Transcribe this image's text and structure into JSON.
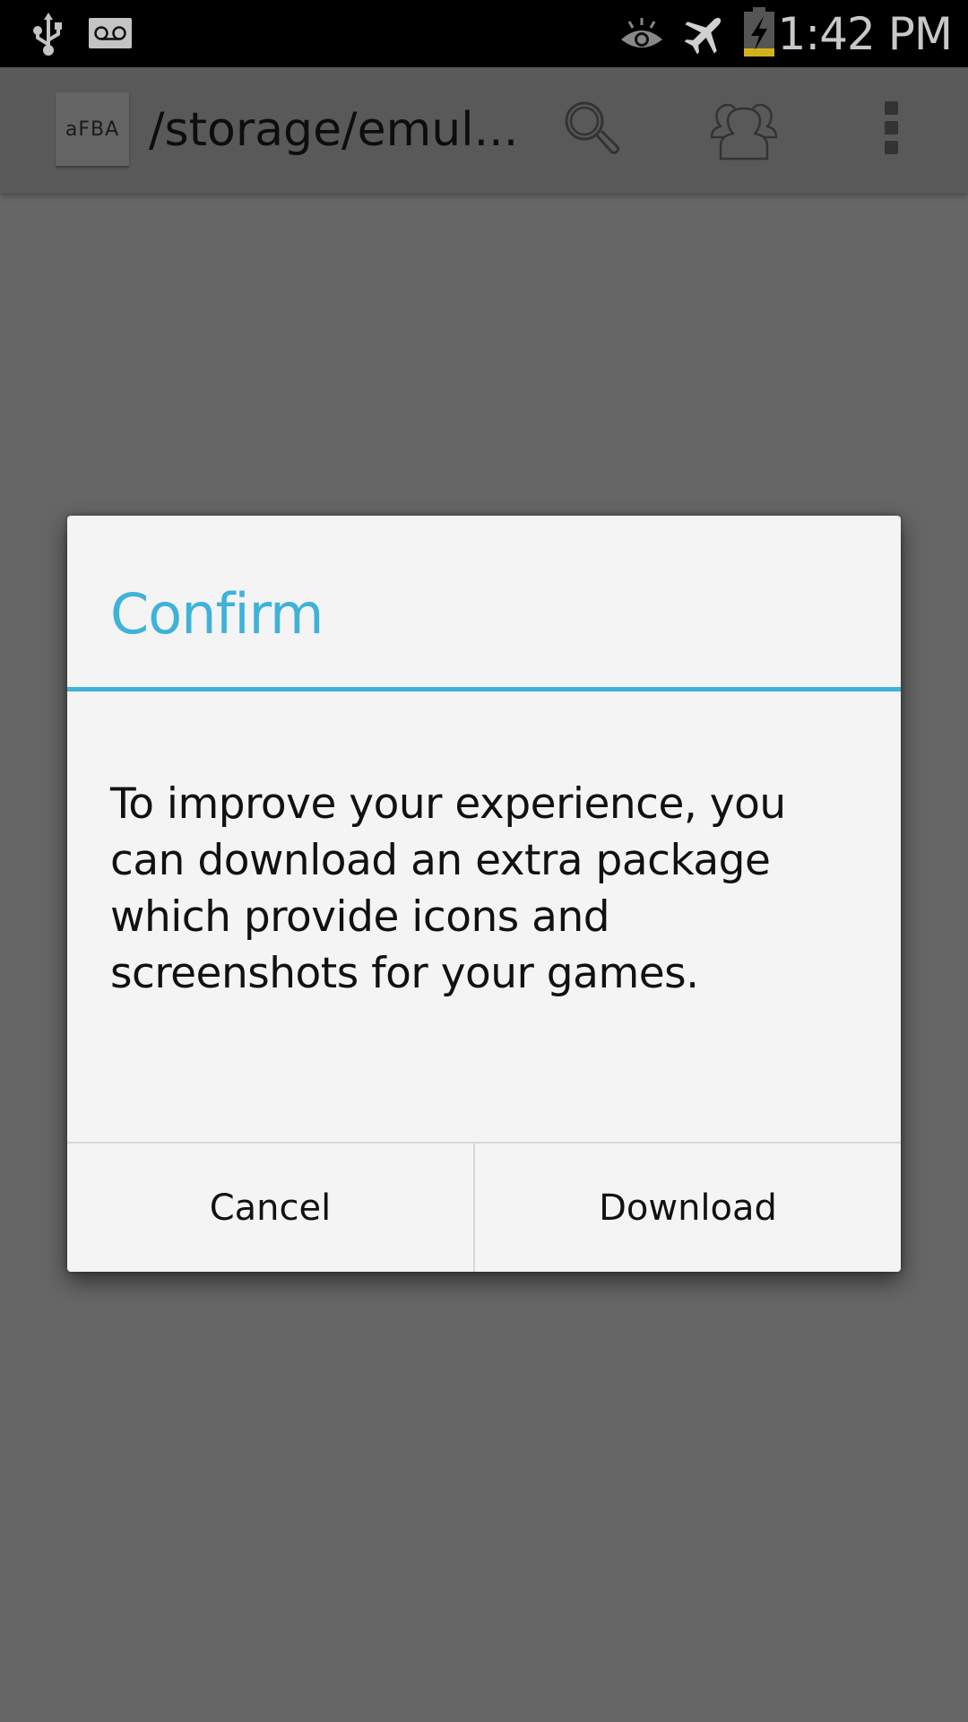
{
  "status_bar": {
    "time": "1:42 PM",
    "icons": [
      "usb-icon",
      "voicemail-icon",
      "eye-icon",
      "airplane-mode-icon",
      "battery-charging-icon"
    ],
    "battery_level_color": "#d4b21c"
  },
  "action_bar": {
    "app_logo_text": "aFBA",
    "title": "/storage/emul...",
    "actions": [
      {
        "name": "search",
        "icon": "search-icon"
      },
      {
        "name": "people",
        "icon": "people-icon"
      },
      {
        "name": "overflow",
        "icon": "overflow-menu-icon"
      }
    ]
  },
  "dialog": {
    "title": "Confirm",
    "message": "To improve your experience, you can download an extra package which provide icons and screenshots for your games.",
    "buttons": {
      "cancel": "Cancel",
      "download": "Download"
    },
    "accent_color": "#3fb2d8"
  }
}
